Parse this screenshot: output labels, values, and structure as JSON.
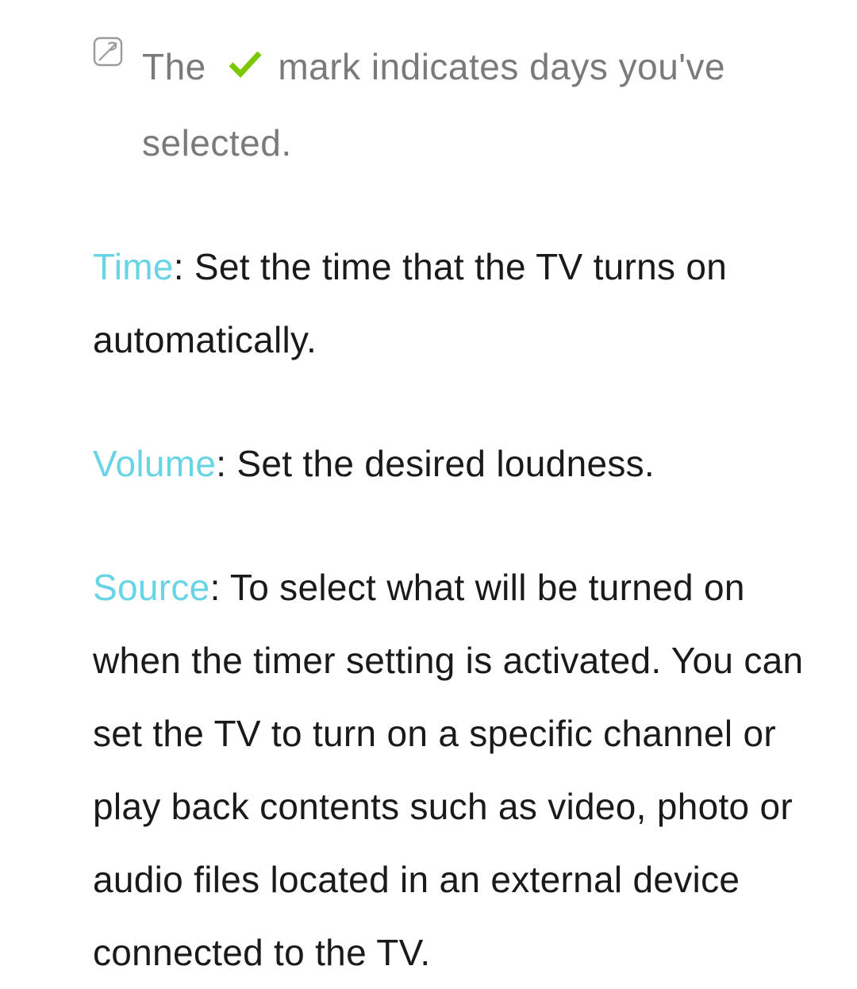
{
  "note": {
    "part1": "The",
    "part2": " mark indicates days you've selected."
  },
  "entries": {
    "time": {
      "keyword": "Time",
      "desc": ": Set the time that the TV turns on automatically."
    },
    "volume": {
      "keyword": "Volume",
      "desc": ": Set the desired loudness."
    },
    "source": {
      "keyword": "Source",
      "desc": ": To select what will be turned on when the timer setting is activated. You can set the TV to turn on a specific channel or play back contents such as video, photo or audio files located in an external device connected to the TV."
    }
  }
}
